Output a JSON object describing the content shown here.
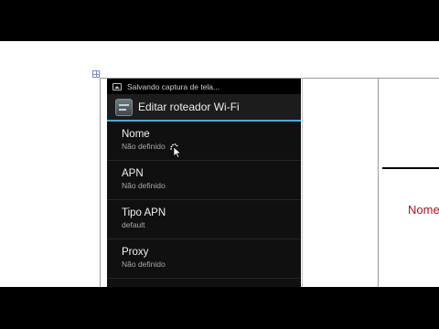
{
  "document": {
    "right_label": "Nome"
  },
  "phone": {
    "status_bar": {
      "notification_icon": "image-icon",
      "text": "Salvando captura de tela..."
    },
    "action_bar": {
      "icon": "settings-app-icon",
      "title": "Editar roteador Wi-Fi"
    },
    "preferences": [
      {
        "title": "Nome",
        "summary": "Não definido"
      },
      {
        "title": "APN",
        "summary": "Não definido"
      },
      {
        "title": "Tipo APN",
        "summary": "default"
      },
      {
        "title": "Proxy",
        "summary": "Não definido"
      }
    ]
  },
  "colors": {
    "accent": "#33b5e5",
    "doc_label": "#b01020",
    "background": "#101010"
  }
}
